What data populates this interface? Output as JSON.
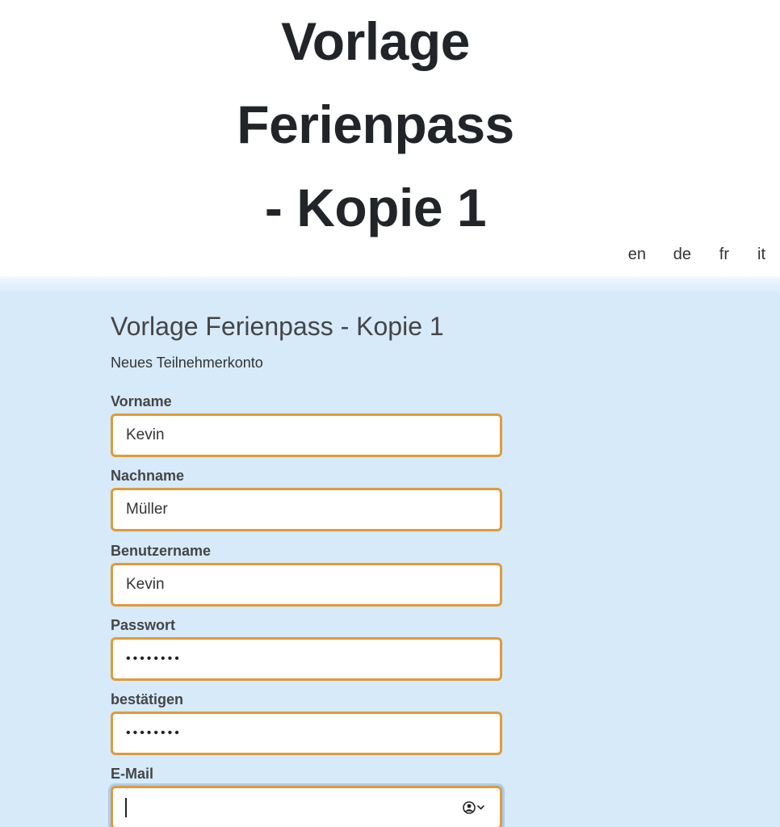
{
  "header": {
    "title_lines": [
      "Vorlage",
      "Ferienpass",
      "- Kopie 1"
    ]
  },
  "languages": [
    "en",
    "de",
    "fr",
    "it"
  ],
  "form": {
    "title": "Vorlage Ferienpass - Kopie 1",
    "subtitle": "Neues Teilnehmerkonto",
    "fields": [
      {
        "label": "Vorname",
        "value": "Kevin"
      },
      {
        "label": "Nachname",
        "value": "Müller"
      },
      {
        "label": "Benutzername",
        "value": "Kevin"
      },
      {
        "label": "Passwort",
        "value": "••••••••"
      },
      {
        "label": "bestätigen",
        "value": "••••••••"
      },
      {
        "label": "E-Mail",
        "value": ""
      }
    ]
  },
  "icons": {
    "email_autofill": "contact-autofill-icon"
  },
  "colors": {
    "background_main": "#d6eafa",
    "input_border": "#e09a3a",
    "focus_ring": "#a9cdf3",
    "text_dark": "#212529"
  }
}
